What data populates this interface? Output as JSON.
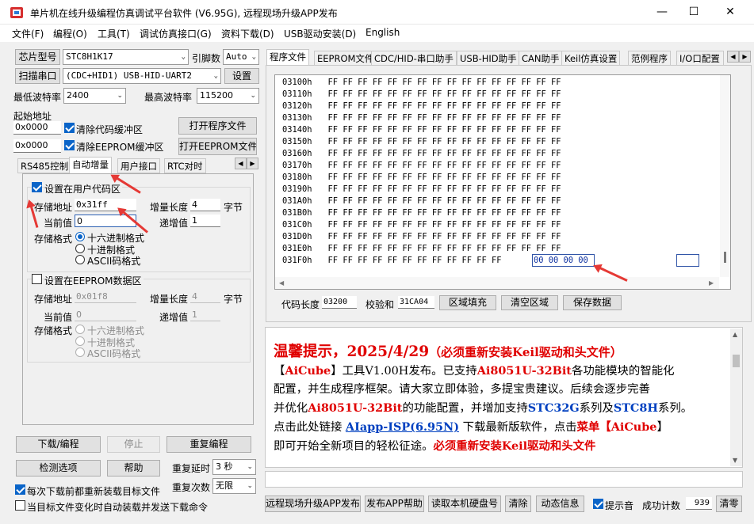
{
  "window": {
    "title": "单片机在线升级编程仿真调试平台软件 (V6.95G), 远程现场升级APP发布",
    "min": "—",
    "max": "☐",
    "close": "✕"
  },
  "menu": [
    "文件(F)",
    "编程(O)",
    "工具(T)",
    "调试仿真接口(G)",
    "资料下载(D)",
    "USB驱动安装(D)",
    "English"
  ],
  "left": {
    "chip_btn": "芯片型号",
    "chip_value": "STC8H1K17",
    "pins_label": "引脚数",
    "pins_value": "Auto",
    "scan_btn": "扫描串口",
    "port_value": "(CDC+HID1) USB-HID-UART2",
    "settings_btn": "设置",
    "min_baud_label": "最低波特率",
    "min_baud": "2400",
    "max_baud_label": "最高波特率",
    "max_baud": "115200",
    "start_addr_label": "起始地址",
    "addr1": "0x0000",
    "clear_code": "清除代码缓冲区",
    "open_prog": "打开程序文件",
    "addr2": "0x0000",
    "clear_eeprom": "清除EEPROM缓冲区",
    "open_eeprom": "打开EEPROM文件",
    "tabs": [
      "RS485控制",
      "自动增量",
      "用户接口",
      "RTC对时"
    ],
    "user_section": {
      "title": "设置在用户代码区",
      "addr_label": "存储地址",
      "addr": "0x31ff",
      "len_label": "增量长度",
      "len": "4",
      "unit": "字节",
      "cur_label": "当前值",
      "cur": "0",
      "inc_label": "递增值",
      "inc": "1",
      "fmt_label": "存储格式",
      "fmt": [
        "十六进制格式",
        "十进制格式",
        "ASCII码格式"
      ]
    },
    "ee_section": {
      "title": "设置在EEPROM数据区",
      "addr_label": "存储地址",
      "addr": "0x01f8",
      "len_label": "增量长度",
      "len": "4",
      "unit": "字节",
      "cur_label": "当前值",
      "cur": "0",
      "inc_label": "递增值",
      "inc": "1",
      "fmt_label": "存储格式",
      "fmt": [
        "十六进制格式",
        "十进制格式",
        "ASCII码格式"
      ]
    },
    "download_btn": "下载/编程",
    "stop_btn": "停止",
    "repeat_btn": "重复编程",
    "check_btn": "检测选项",
    "help_btn": "帮助",
    "delay_label": "重复延时",
    "delay": "3 秒",
    "reload_chk": "每次下载前都重新装载目标文件",
    "count_label": "重复次数",
    "count": "无限",
    "auto_chk": "当目标文件变化时自动装载并发送下载命令"
  },
  "right": {
    "tabs": [
      "程序文件",
      "EEPROM文件",
      "CDC/HID-串口助手",
      "USB-HID助手",
      "CAN助手",
      "Keil仿真设置",
      "范例程序",
      "I/O口配置"
    ],
    "hex_rows": [
      {
        "addr": "03100h",
        "bytes": "FF FF FF FF FF FF FF FF FF FF FF FF FF FF FF FF"
      },
      {
        "addr": "03110h",
        "bytes": "FF FF FF FF FF FF FF FF FF FF FF FF FF FF FF FF"
      },
      {
        "addr": "03120h",
        "bytes": "FF FF FF FF FF FF FF FF FF FF FF FF FF FF FF FF"
      },
      {
        "addr": "03130h",
        "bytes": "FF FF FF FF FF FF FF FF FF FF FF FF FF FF FF FF"
      },
      {
        "addr": "03140h",
        "bytes": "FF FF FF FF FF FF FF FF FF FF FF FF FF FF FF FF"
      },
      {
        "addr": "03150h",
        "bytes": "FF FF FF FF FF FF FF FF FF FF FF FF FF FF FF FF"
      },
      {
        "addr": "03160h",
        "bytes": "FF FF FF FF FF FF FF FF FF FF FF FF FF FF FF FF"
      },
      {
        "addr": "03170h",
        "bytes": "FF FF FF FF FF FF FF FF FF FF FF FF FF FF FF FF"
      },
      {
        "addr": "03180h",
        "bytes": "FF FF FF FF FF FF FF FF FF FF FF FF FF FF FF FF"
      },
      {
        "addr": "03190h",
        "bytes": "FF FF FF FF FF FF FF FF FF FF FF FF FF FF FF FF"
      },
      {
        "addr": "031A0h",
        "bytes": "FF FF FF FF FF FF FF FF FF FF FF FF FF FF FF FF"
      },
      {
        "addr": "031B0h",
        "bytes": "FF FF FF FF FF FF FF FF FF FF FF FF FF FF FF FF"
      },
      {
        "addr": "031C0h",
        "bytes": "FF FF FF FF FF FF FF FF FF FF FF FF FF FF FF FF"
      },
      {
        "addr": "031D0h",
        "bytes": "FF FF FF FF FF FF FF FF FF FF FF FF FF FF FF FF"
      },
      {
        "addr": "031E0h",
        "bytes": "FF FF FF FF FF FF FF FF FF FF FF FF FF FF FF FF"
      },
      {
        "addr": "031F0h",
        "bytes": "FF FF FF FF FF FF FF FF FF FF FF FF"
      }
    ],
    "selected_bytes": "00 00 00 00",
    "code_len_label": "代码长度",
    "code_len": "03200",
    "checksum_label": "校验和",
    "checksum": "31CA04",
    "fill_btn": "区域填充",
    "clear_btn": "清空区域",
    "save_btn": "保存数据",
    "notice": {
      "title": "温馨提示，2025/4/29",
      "title_sub": "（必须重新安装Keil驱动和头文件）",
      "l1a": "【",
      "l1b": "AiCube",
      "l1c": "】工具V1.00H发布。已支持",
      "l1d": "Ai8051U-32Bit",
      "l1e": "各功能模块的智能化",
      "l2": "配置，并生成程序框架。请大家立即体验，多提宝贵建议。后续会逐步完善",
      "l3a": "并优化",
      "l3b": "Ai8051U-32Bit",
      "l3c": "的功能配置，并增加支持",
      "l3d": "STC32G",
      "l3e": "系列及",
      "l3f": "STC8H",
      "l3g": "系列。",
      "l4a": "点击此处链接 ",
      "l4b": "AIapp-ISP(6.95N)",
      "l4c": " 下载最新版软件，点击",
      "l4d": "菜单【",
      "l4e": "AiCube",
      "l4f": "】",
      "l5a": "即可开始全新项目的轻松征途。",
      "l5b": "必须重新安装Keil驱动和头文件"
    },
    "bottom": {
      "publish": "远程现场升级APP发布",
      "app_help": "发布APP帮助",
      "read_disk": "读取本机硬盘号",
      "clear": "清除",
      "dyn_info": "动态信息",
      "beep": "提示音",
      "success_label": "成功计数",
      "success": "939",
      "reset": "清零"
    }
  }
}
